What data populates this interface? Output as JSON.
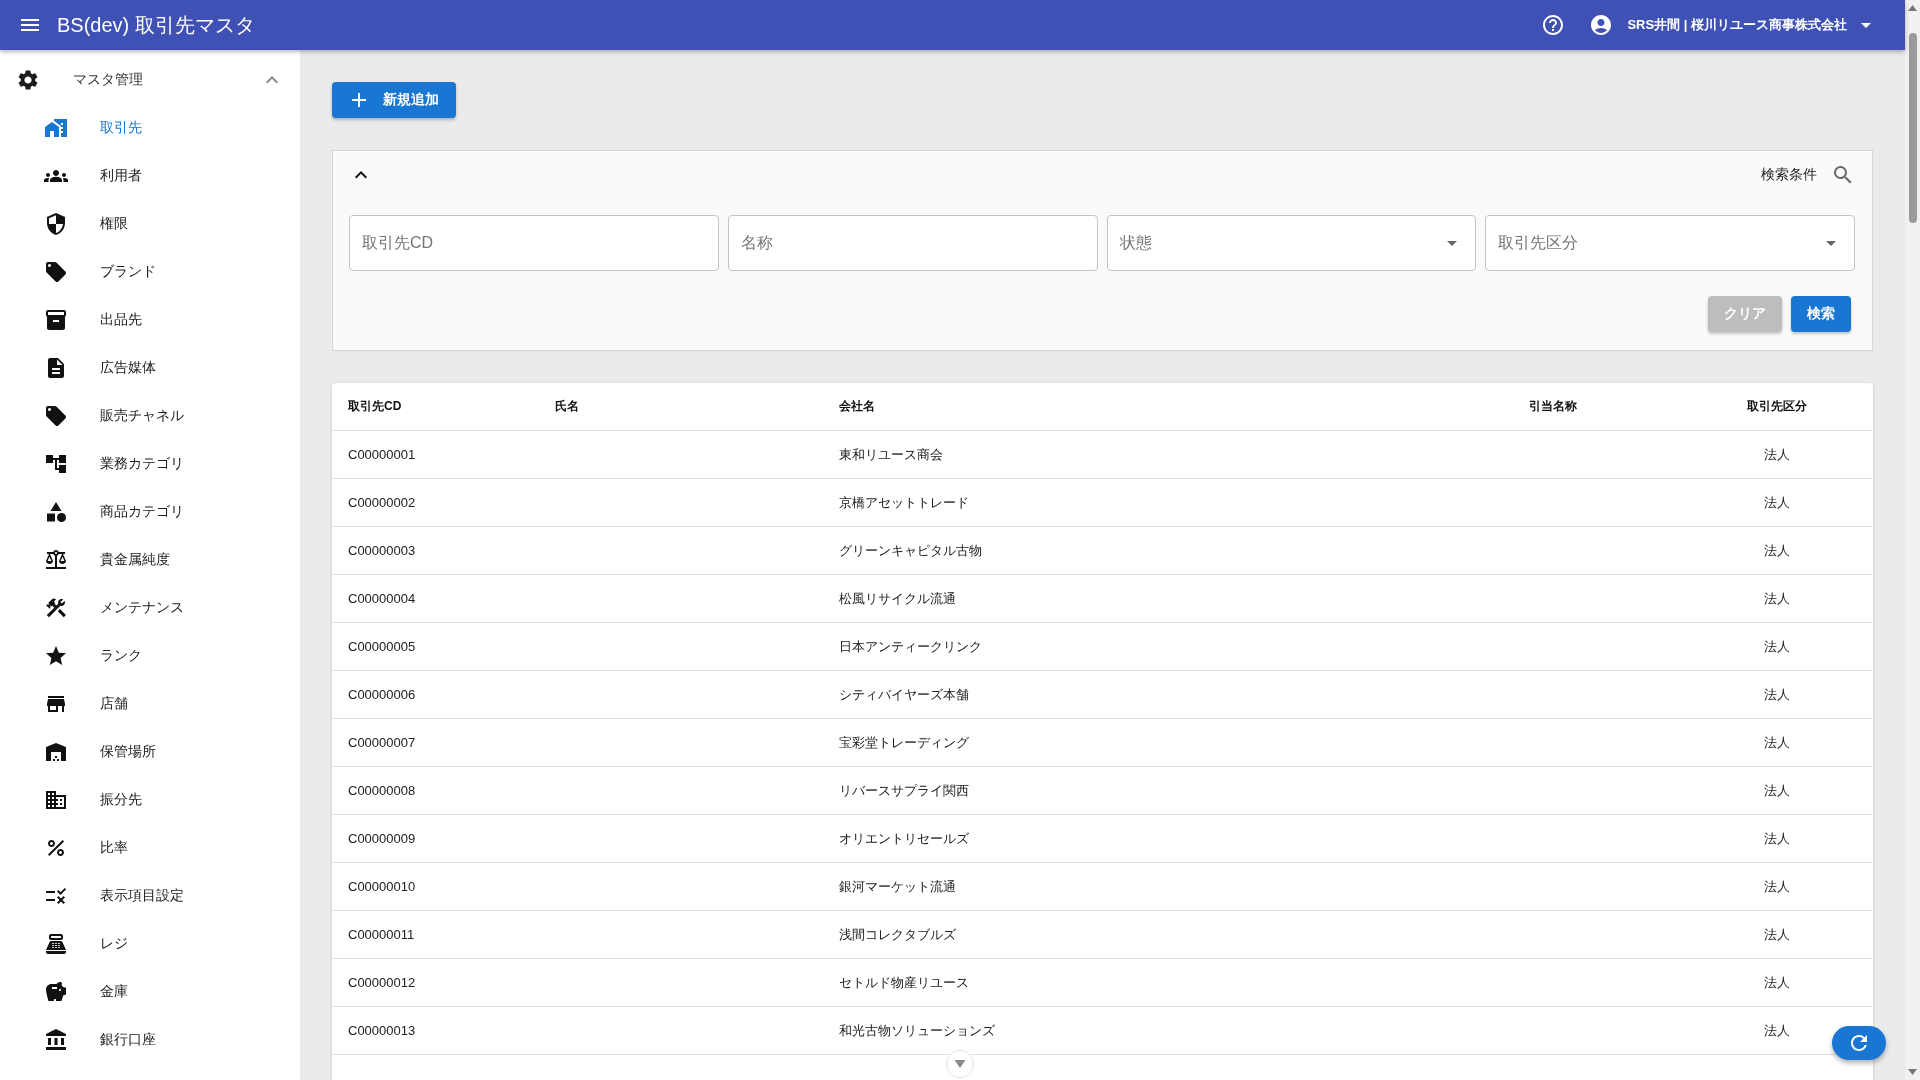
{
  "app_bar": {
    "title": "BS(dev) 取引先マスタ",
    "user": "SRS井間 | 桜川リユース商事株式会社"
  },
  "sidebar": {
    "groups": [
      {
        "label": "マスタ管理",
        "expanded": true,
        "items": [
          {
            "label": "取引先",
            "selected": true
          },
          {
            "label": "利用者",
            "selected": false
          },
          {
            "label": "権限",
            "selected": false
          },
          {
            "label": "ブランド",
            "selected": false
          },
          {
            "label": "出品先",
            "selected": false
          },
          {
            "label": "広告媒体",
            "selected": false
          },
          {
            "label": "販売チャネル",
            "selected": false
          },
          {
            "label": "業務カテゴリ",
            "selected": false
          },
          {
            "label": "商品カテゴリ",
            "selected": false
          },
          {
            "label": "貴金属純度",
            "selected": false
          },
          {
            "label": "メンテナンス",
            "selected": false
          },
          {
            "label": "ランク",
            "selected": false
          },
          {
            "label": "店舗",
            "selected": false
          },
          {
            "label": "保管場所",
            "selected": false
          },
          {
            "label": "振分先",
            "selected": false
          },
          {
            "label": "比率",
            "selected": false
          },
          {
            "label": "表示項目設定",
            "selected": false
          },
          {
            "label": "レジ",
            "selected": false
          },
          {
            "label": "金庫",
            "selected": false
          },
          {
            "label": "銀行口座",
            "selected": false
          }
        ]
      }
    ]
  },
  "add_button": {
    "label": "新規追加"
  },
  "search_panel": {
    "expanded": true,
    "title": "検索条件",
    "fields": [
      {
        "kind": "text",
        "placeholder": "取引先CD"
      },
      {
        "kind": "text",
        "placeholder": "名称"
      },
      {
        "kind": "select",
        "placeholder": "状態"
      },
      {
        "kind": "select",
        "placeholder": "取引先区分"
      }
    ],
    "buttons": [
      {
        "label": "クリア",
        "kind": "secondary"
      },
      {
        "label": "検索",
        "kind": "primary"
      }
    ]
  },
  "table": {
    "columns": [
      "取引先CD",
      "氏名",
      "会社名",
      "引当名称",
      "取引先区分"
    ],
    "rows": [
      {
        "code": "C00000001",
        "company": "東和リユース商会",
        "category": "法人"
      },
      {
        "code": "C00000002",
        "company": "京橋アセットトレード",
        "category": "法人"
      },
      {
        "code": "C00000003",
        "company": "グリーンキャピタル古物",
        "category": "法人"
      },
      {
        "code": "C00000004",
        "company": "松風リサイクル流通",
        "category": "法人"
      },
      {
        "code": "C00000005",
        "company": "日本アンティークリンク",
        "category": "法人"
      },
      {
        "code": "C00000006",
        "company": "シティバイヤーズ本舗",
        "category": "法人"
      },
      {
        "code": "C00000007",
        "company": "宝彩堂トレーディング",
        "category": "法人"
      },
      {
        "code": "C00000008",
        "company": "リバースサプライ関西",
        "category": "法人"
      },
      {
        "code": "C00000009",
        "company": "オリエントリセールズ",
        "category": "法人"
      },
      {
        "code": "C00000010",
        "company": "銀河マーケット流通",
        "category": "法人"
      },
      {
        "code": "C00000011",
        "company": "浅間コレクタブルズ",
        "category": "法人"
      },
      {
        "code": "C00000012",
        "company": "セトルド物産リユース",
        "category": "法人"
      },
      {
        "code": "C00000013",
        "company": "和光古物ソリューションズ",
        "category": "法人"
      }
    ]
  }
}
